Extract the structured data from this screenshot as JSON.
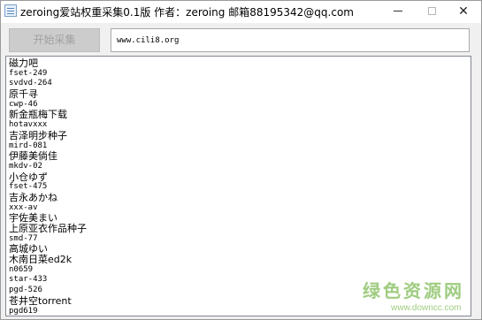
{
  "window": {
    "title": "zeroing爱站权重采集0.1版 作者：zeroing 邮箱88195342@qq.com",
    "controls": {
      "minimize": "—",
      "maximize": "☐",
      "close": "✕"
    }
  },
  "toolbar": {
    "start_label": "开始采集",
    "url_value": "www.cili8.org"
  },
  "output": {
    "lines": [
      {
        "text": "磁力吧",
        "script": "cjk"
      },
      {
        "text": "fset-249",
        "script": "latin"
      },
      {
        "text": "svdvd-264",
        "script": "latin"
      },
      {
        "text": "原千寻",
        "script": "cjk"
      },
      {
        "text": "cwp-46",
        "script": "latin"
      },
      {
        "text": "新金瓶梅下载",
        "script": "cjk"
      },
      {
        "text": "hotavxxx",
        "script": "latin"
      },
      {
        "text": "吉泽明步种子",
        "script": "cjk"
      },
      {
        "text": "mird-081",
        "script": "latin"
      },
      {
        "text": "伊藤美倘佳",
        "script": "cjk"
      },
      {
        "text": "mkdv-02",
        "script": "latin"
      },
      {
        "text": "小仓ゆず",
        "script": "cjk"
      },
      {
        "text": "fset-475",
        "script": "latin"
      },
      {
        "text": "吉永あかね",
        "script": "cjk"
      },
      {
        "text": "xxx-av",
        "script": "latin"
      },
      {
        "text": "宇佐美まい",
        "script": "cjk"
      },
      {
        "text": "上原亚衣作品种子",
        "script": "cjk"
      },
      {
        "text": "smd-77",
        "script": "latin"
      },
      {
        "text": "高城ゆい",
        "script": "cjk"
      },
      {
        "text": "木南日菜ed2k",
        "script": "cjk"
      },
      {
        "text": "n0659",
        "script": "latin"
      },
      {
        "text": "star-433",
        "script": "latin"
      },
      {
        "text": "pgd-526",
        "script": "latin"
      },
      {
        "text": "苍井空torrent",
        "script": "cjk"
      },
      {
        "text": "pgd619",
        "script": "latin"
      }
    ]
  },
  "watermark": {
    "main": "绿色资源网",
    "sub": "www.downcc.com"
  }
}
